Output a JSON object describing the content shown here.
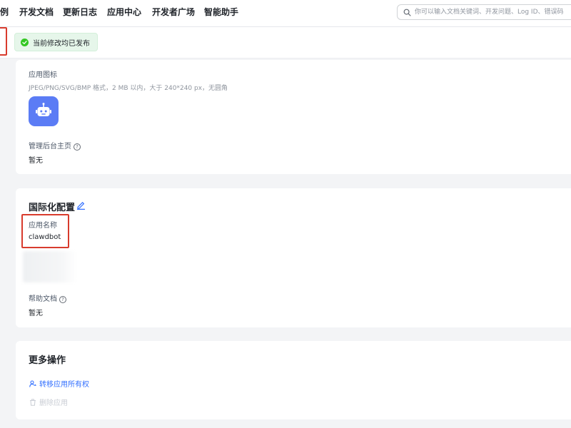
{
  "nav": {
    "items": [
      "例",
      "开发文档",
      "更新日志",
      "应用中心",
      "开发者广场",
      "智能助手"
    ]
  },
  "search": {
    "placeholder": "你可以输入文档关键词、开发问题、Log ID、错误码"
  },
  "status": {
    "publish_text": "当前修改均已发布"
  },
  "basic_info": {
    "app_icon_label": "应用图标",
    "app_icon_hint": "JPEG/PNG/SVG/BMP 格式，2 MB 以内，大于 240*240 px，无圆角",
    "admin_home_label": "管理后台主页",
    "admin_home_value": "暂无"
  },
  "i18n": {
    "title": "国际化配置",
    "app_name_label": "应用名称",
    "app_name_value": "clawdbot",
    "help_doc_label": "帮助文档",
    "help_doc_value": "暂无"
  },
  "more_actions": {
    "title": "更多操作",
    "transfer_label": "转移应用所有权",
    "delete_label": "删除应用"
  },
  "colors": {
    "link_blue": "#3370ff",
    "success_green": "#34c724",
    "highlight_red": "#d83b2d",
    "disabled_gray": "#c9cdd4"
  }
}
